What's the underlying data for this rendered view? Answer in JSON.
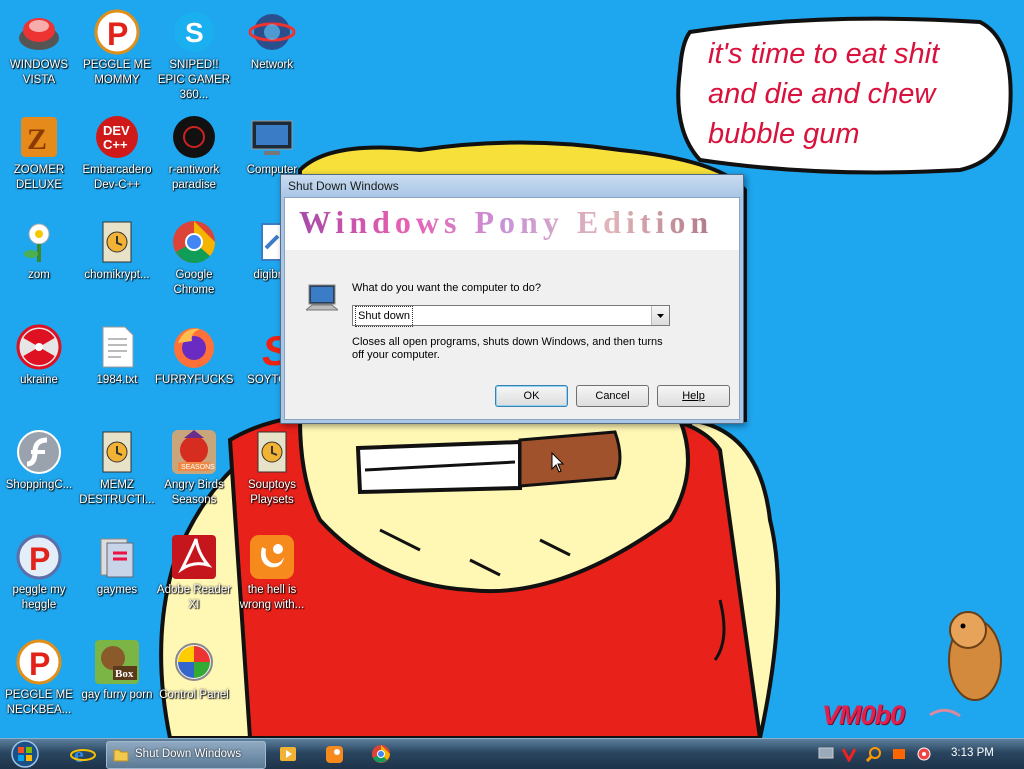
{
  "wallpaper": {
    "speech_bubble": {
      "lines": [
        "it's time to eat shit",
        "and die and chew",
        "bubble gum"
      ]
    },
    "watermark": "VM0b0"
  },
  "desktop_icons": [
    {
      "label": "WINDOWS VISTA",
      "icon": "vista-app-icon"
    },
    {
      "label": "PEGGLE ME MOMMY",
      "icon": "peggle-icon"
    },
    {
      "label": "SNIPED!! EPIC GAMER 360...",
      "icon": "skype-icon"
    },
    {
      "label": "Network",
      "icon": "network-icon"
    },
    {
      "label": "ZOOMER DELUXE",
      "icon": "zuma-icon"
    },
    {
      "label": "Embarcadero Dev-C++",
      "icon": "devcpp-icon"
    },
    {
      "label": "r-antiwork paradise",
      "icon": "black-circle-icon"
    },
    {
      "label": "Computer",
      "icon": "computer-icon"
    },
    {
      "label": "zom",
      "icon": "plant-icon"
    },
    {
      "label": "chomikrypt...",
      "icon": "document-icon"
    },
    {
      "label": "Google Chrome",
      "icon": "chrome-icon"
    },
    {
      "label": "digibr...",
      "icon": "installer-icon"
    },
    {
      "label": "ukraine",
      "icon": "radiation-icon"
    },
    {
      "label": "1984.txt",
      "icon": "text-file-icon"
    },
    {
      "label": "FURRYFUCKS",
      "icon": "firefox-icon"
    },
    {
      "label": "SOYTO...",
      "icon": "red-logo-icon"
    },
    {
      "label": "ShoppingC...",
      "icon": "flash-icon"
    },
    {
      "label": "MEMZ DESTRUCTI...",
      "icon": "document-icon"
    },
    {
      "label": "Angry Birds Seasons",
      "icon": "angry-birds-icon"
    },
    {
      "label": "Souptoys Playsets",
      "icon": "document-icon"
    },
    {
      "label": "peggle my heggle",
      "icon": "peggle-icon"
    },
    {
      "label": "gaymes",
      "icon": "folder-icon"
    },
    {
      "label": "Adobe Reader XI",
      "icon": "adobe-reader-icon"
    },
    {
      "label": "the hell is wrong with...",
      "icon": "uc-browser-icon"
    },
    {
      "label": "PEGGLE ME NECKBEA...",
      "icon": "peggle-icon"
    },
    {
      "label": "gay furry porn",
      "icon": "box-game-icon"
    },
    {
      "label": "Control Panel",
      "icon": "control-panel-icon"
    }
  ],
  "dialog": {
    "title": "Shut Down Windows",
    "banner": "Windows Pony Edition",
    "question": "What do you want the computer to do?",
    "selected_option": "Shut down",
    "description": "Closes all open programs, shuts down Windows, and then turns off your computer.",
    "buttons": {
      "ok": "OK",
      "cancel": "Cancel",
      "help": "Help"
    }
  },
  "taskbar": {
    "active_window": "Shut Down Windows",
    "clock": "3:13 PM"
  }
}
